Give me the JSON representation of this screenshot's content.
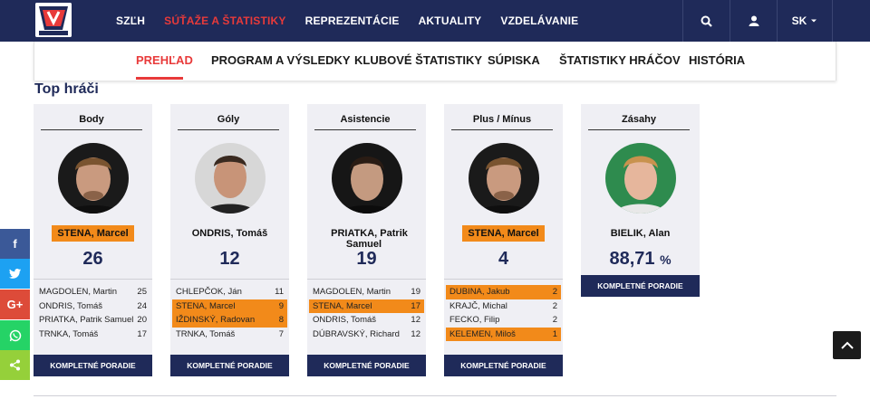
{
  "header": {
    "logo_alt": "SLOVAKIA",
    "nav": [
      {
        "label": "SZĽH",
        "active": false
      },
      {
        "label": "SÚŤAŽE A ŠTATISTIKY",
        "active": true
      },
      {
        "label": "REPREZENTÁCIE",
        "active": false
      },
      {
        "label": "AKTUALITY",
        "active": false
      },
      {
        "label": "VZDELÁVANIE",
        "active": false
      }
    ],
    "search_icon": "search-icon",
    "user_icon": "user-icon",
    "lang": "SK"
  },
  "subnav": [
    {
      "label": "PREHĽAD",
      "active": true
    },
    {
      "label": "PROGRAM A VÝSLEDKY",
      "active": false
    },
    {
      "label": "KLUBOVÉ ŠTATISTIKY",
      "active": false
    },
    {
      "label": "SÚPISKA",
      "active": false
    },
    {
      "label": "ŠTATISTIKY HRÁČOV",
      "active": false
    },
    {
      "label": "HISTÓRIA",
      "active": false
    }
  ],
  "section_title": "Top hráči",
  "more_label": "KOMPLETNÉ PORADIE",
  "cards": [
    {
      "title": "Body",
      "leader": {
        "name": "STENA, Marcel",
        "value": "26",
        "highlight": true
      },
      "rows": [
        {
          "name": "MAGDOLEN, Martin",
          "value": "25",
          "highlight": false
        },
        {
          "name": "ONDRIS, Tomáš",
          "value": "24",
          "highlight": false
        },
        {
          "name": "PRIATKA, Patrik Samuel",
          "value": "20",
          "highlight": false
        },
        {
          "name": "TRNKA, Tomáš",
          "value": "17",
          "highlight": false
        }
      ]
    },
    {
      "title": "Góly",
      "leader": {
        "name": "ONDRIS, Tomáš",
        "value": "12",
        "highlight": false
      },
      "rows": [
        {
          "name": "CHLEPČOK, Ján",
          "value": "11",
          "highlight": false
        },
        {
          "name": "STENA, Marcel",
          "value": "9",
          "highlight": true
        },
        {
          "name": "IŽDINSKÝ, Radovan",
          "value": "8",
          "highlight": true
        },
        {
          "name": "TRNKA, Tomáš",
          "value": "7",
          "highlight": false
        }
      ]
    },
    {
      "title": "Asistencie",
      "leader": {
        "name": "PRIATKA, Patrik Samuel",
        "value": "19",
        "highlight": false
      },
      "rows": [
        {
          "name": "MAGDOLEN, Martin",
          "value": "19",
          "highlight": false
        },
        {
          "name": "STENA, Marcel",
          "value": "17",
          "highlight": true
        },
        {
          "name": "ONDRIS, Tomáš",
          "value": "12",
          "highlight": false
        },
        {
          "name": "DÚBRAVSKÝ, Richard",
          "value": "12",
          "highlight": false
        }
      ]
    },
    {
      "title": "Plus / Mínus",
      "leader": {
        "name": "STENA, Marcel",
        "value": "4",
        "highlight": true
      },
      "rows": [
        {
          "name": "DUBINA, Jakub",
          "value": "2",
          "highlight": true
        },
        {
          "name": "KRAJČ, Michal",
          "value": "2",
          "highlight": false
        },
        {
          "name": "FECKO, Filip",
          "value": "2",
          "highlight": false
        },
        {
          "name": "KELEMEN, Miloš",
          "value": "1",
          "highlight": true
        }
      ]
    },
    {
      "title": "Zásahy",
      "leader": {
        "name": "BIELIK, Alan",
        "value": "88,71",
        "unit": "%",
        "highlight": false
      },
      "rows": []
    }
  ],
  "social": [
    {
      "icon": "facebook-icon",
      "glyph": "f",
      "color": "#3b5998"
    },
    {
      "icon": "twitter-icon",
      "glyph": "t",
      "color": "#1da1f2"
    },
    {
      "icon": "google-plus-icon",
      "glyph": "G+",
      "color": "#dd4b39"
    },
    {
      "icon": "whatsapp-icon",
      "glyph": "w",
      "color": "#25d366"
    },
    {
      "icon": "share-icon",
      "glyph": "<",
      "color": "#95d03a"
    }
  ],
  "colors": {
    "navy": "#1f2a59",
    "red": "#e83a3a",
    "orange": "#f28a1a",
    "card_bg": "#efeff4"
  }
}
